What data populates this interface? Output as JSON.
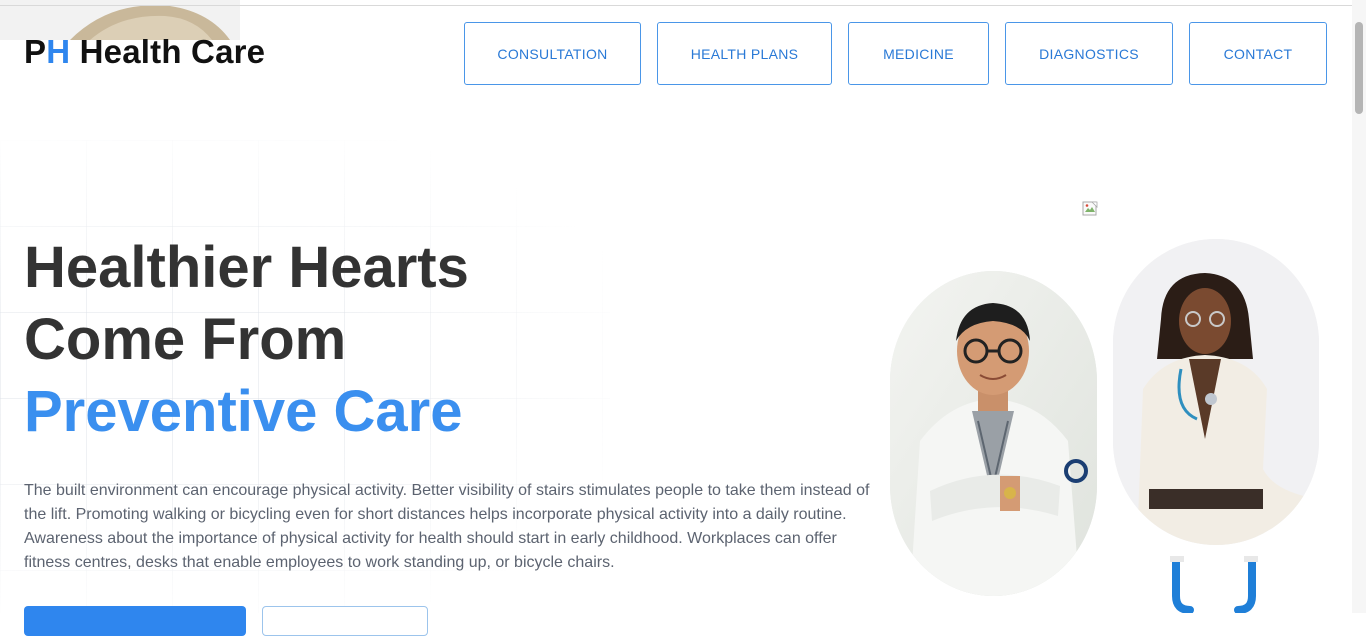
{
  "brand": {
    "p": "P",
    "h": "H",
    "rest": " Health Care"
  },
  "nav": {
    "items": [
      {
        "label": "CONSULTATION"
      },
      {
        "label": "HEALTH PLANS"
      },
      {
        "label": "MEDICINE"
      },
      {
        "label": "DIAGNOSTICS"
      },
      {
        "label": "CONTACT"
      }
    ]
  },
  "hero": {
    "line1": "Healthier Hearts",
    "line2": "Come From",
    "line3": "Preventive Care",
    "description": "The built environment can encourage physical activity. Better visibility of stairs stimulates people to take them instead of the lift. Promoting walking or bicycling even for short distances helps incorporate physical activity into a daily routine. Awareness about the importance of physical activity for health should start in early childhood. Workplaces can offer fitness centres, desks that enable employees to work standing up, or bicycle chairs."
  },
  "colors": {
    "accent": "#2f86ee",
    "heading": "#333333",
    "stethoscope": "#1f7fd8"
  },
  "icons": {
    "broken_image": "broken-image-icon",
    "stethoscope": "stethoscope-icon"
  }
}
